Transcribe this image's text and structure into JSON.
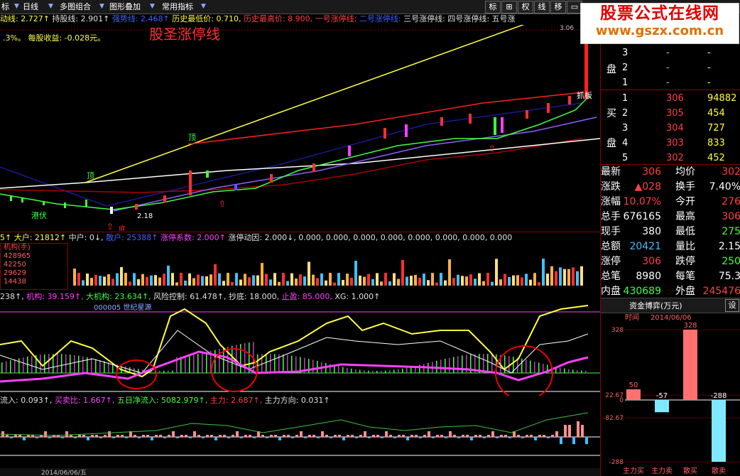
{
  "toolbar": {
    "items": [
      "标",
      "日线",
      "多图组合",
      "图形叠加",
      "常用指标"
    ],
    "right_buttons": [
      "标",
      "⊞",
      "权",
      "线",
      "移"
    ]
  },
  "brand": {
    "line1": "股票公式在线网",
    "line2": "www.gszx.com.cn"
  },
  "info": {
    "a_label": "动线: ",
    "a_val": "2.727↑",
    "b_label": "持股线: ",
    "b_val": "2.901↑",
    "c_label": "强势线: ",
    "c_val": "2.468↑",
    "d_label": "历史最低价: ",
    "d_val": "0.710,",
    "e_label": "历史最高价: ",
    "e_val": "8.900,",
    "f": "一号涨停线:",
    "g": "二号涨停线:",
    "h": "三号涨停线:",
    "i": "四号涨停线:",
    "j": "五号涨",
    "sub": ".3%。 每股收益: -0.028元。",
    "overlay_title": "股圣涨停线",
    "price_tag": "3.06"
  },
  "main_labels": {
    "top1": "顶",
    "top2": "顶",
    "low_tag": "港伏",
    "low_price": "2.18",
    "zhuaban": "抓板",
    "di": "底"
  },
  "volbar": {
    "a": "5↑",
    "b_label": "大户: ",
    "b_val": "21812↑",
    "c": "中户: 0↓,",
    "d_label": "散户: ",
    "d_val": "25388↑",
    "e": "涨停系数: 2.000↑",
    "f": "涨停动因: 2.000↓, 0.000, 0.000, 0.000, 0.000, 0.000, 0.000, 0.000, 0.000"
  },
  "volbox": {
    "title": "机构(手)",
    "values": [
      "428965",
      "42250",
      "29629",
      "14438"
    ]
  },
  "indbar": {
    "a": "238↑,",
    "b": "机构: 39.159↑,",
    "c": "大机构: 23.634↑,",
    "d": "风险控制: 61.478↑,",
    "e": "抄底: 18.000,",
    "f": "止盈: 85.000,",
    "g": "XG: 1.000↑"
  },
  "ind_label": "000005 世纪星源",
  "flowbar": {
    "a": "流入: 0.093↑,",
    "b": "买卖比: 1.667↑,",
    "c": "五日净流入: 5082.979↑,",
    "d": "主力: 2.687↑,",
    "e": "主力方向: 0.031↑"
  },
  "bottom_strip": "2014/06/06/五",
  "orderbook": {
    "sell": [
      {
        "n": "3",
        "p": "-",
        "v": "-"
      },
      {
        "n": "2",
        "p": "-",
        "v": "-"
      },
      {
        "n": "1",
        "p": "-",
        "v": "-"
      }
    ],
    "sell_label": [
      "盘"
    ],
    "buy_label": [
      "买",
      "盘"
    ],
    "buy": [
      {
        "n": "1",
        "p": "306",
        "v": "94882"
      },
      {
        "n": "2",
        "p": "305",
        "v": "454"
      },
      {
        "n": "3",
        "p": "304",
        "v": "727"
      },
      {
        "n": "4",
        "p": "303",
        "v": "833"
      },
      {
        "n": "5",
        "p": "302",
        "v": "452"
      }
    ]
  },
  "quote": [
    {
      "l1": "最新",
      "v1": "306",
      "l2": "均价",
      "v2": "302"
    },
    {
      "l1": "涨跌",
      "v1": "▲028",
      "l2": "换手",
      "v2": "7.40%"
    },
    {
      "l1": "涨幅",
      "v1": "10.07%",
      "l2": "今开",
      "v2": "276"
    },
    {
      "l1": "总手",
      "v1": "676165",
      "l2": "最高",
      "v2": "306"
    },
    {
      "l1": "现手",
      "v1": "380",
      "l2": "最低",
      "v2": "275"
    },
    {
      "l1": "总额",
      "v1": "20421",
      "l2": "量比",
      "v2": "2.15"
    },
    {
      "l1": "涨停",
      "v1": "306",
      "l2": "跌停",
      "v2": "250"
    },
    {
      "l1": "总笔",
      "v1": "8980",
      "l2": "每笔",
      "v2": "75.3"
    },
    {
      "l1": "内盘",
      "v1": "430689",
      "l2": "外盘",
      "v2": "245476"
    }
  ],
  "game": {
    "title": "资金博弈(万元)",
    "settings": "设",
    "time_label": "时间",
    "date": "2014/06/06",
    "axis": [
      "328",
      "22.67",
      "0",
      "-82.67",
      "-288"
    ],
    "bars_labels": [
      "50",
      "-57",
      "328",
      "-288"
    ],
    "categories": [
      "主力买",
      "主力卖",
      "散买",
      "散卖"
    ]
  },
  "chart_data": {
    "type": "bar",
    "title": "资金博弈(万元)",
    "categories": [
      "主力买",
      "主力卖",
      "散买",
      "散卖"
    ],
    "values": [
      50,
      -57,
      328,
      -288
    ],
    "ylim": [
      -288,
      328
    ]
  }
}
